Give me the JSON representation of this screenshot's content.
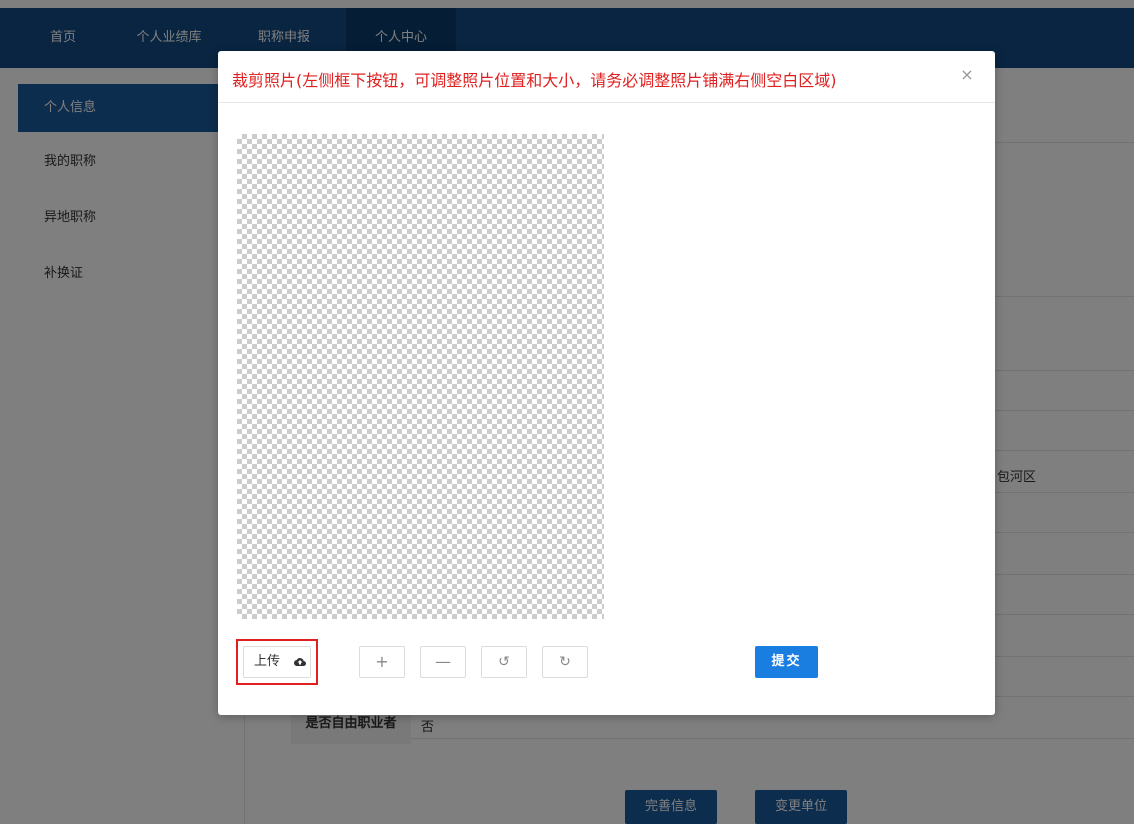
{
  "nav": {
    "items": [
      {
        "label": "首页"
      },
      {
        "label": "个人业绩库"
      },
      {
        "label": "职称申报"
      },
      {
        "label": "个人中心"
      }
    ]
  },
  "sidebar": {
    "items": [
      {
        "label": "个人信息"
      },
      {
        "label": "我的职称"
      },
      {
        "label": "异地职称"
      },
      {
        "label": "补换证"
      }
    ]
  },
  "background": {
    "partial_text": "包河区",
    "row_label": "是否自由职业者",
    "row_value": "否",
    "buttons": {
      "complete": "完善信息",
      "change": "变更单位"
    }
  },
  "modal": {
    "title": "裁剪照片(左侧框下按钮，可调整照片位置和大小，请务必调整照片铺满右侧空白区域)",
    "close_symbol": "×",
    "upload_label": "上传",
    "zoom_in_symbol": "+",
    "zoom_out_symbol": "—",
    "rotate_left_symbol": "↺",
    "rotate_right_symbol": "↻",
    "submit_label": "提交"
  },
  "colors": {
    "nav_bg": "#124a83",
    "title_red": "#e02020",
    "submit_blue": "#1a7de0"
  }
}
